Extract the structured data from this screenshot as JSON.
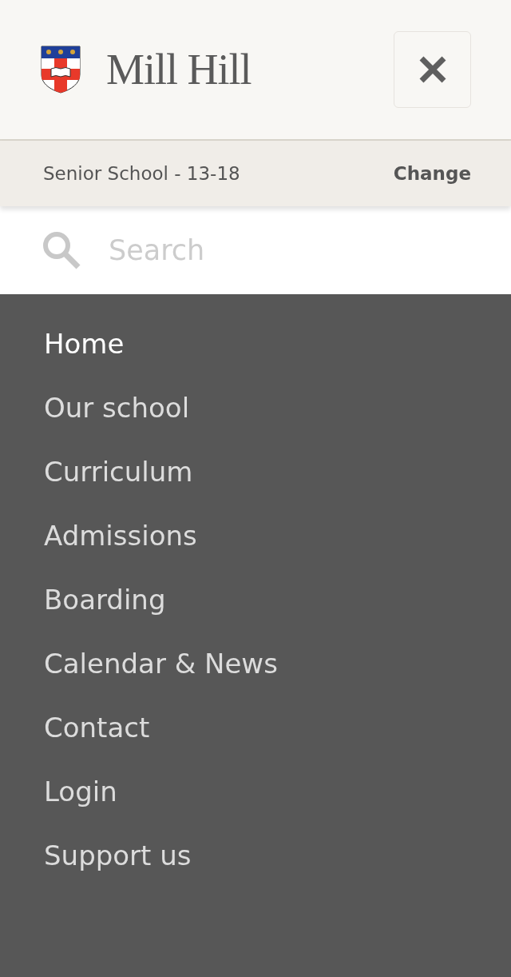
{
  "header": {
    "logo_text": "Mill Hill"
  },
  "school_bar": {
    "label": "Senior School - 13-18",
    "action": "Change"
  },
  "search": {
    "placeholder": "Search"
  },
  "menu": [
    {
      "label": "Home",
      "selected": true
    },
    {
      "label": "Our school",
      "selected": false
    },
    {
      "label": "Curriculum",
      "selected": false
    },
    {
      "label": "Admissions",
      "selected": false
    },
    {
      "label": "Boarding",
      "selected": false
    },
    {
      "label": "Calendar & News",
      "selected": false
    },
    {
      "label": "Contact",
      "selected": false
    },
    {
      "label": "Login",
      "selected": false
    },
    {
      "label": "Support us",
      "selected": false
    }
  ]
}
